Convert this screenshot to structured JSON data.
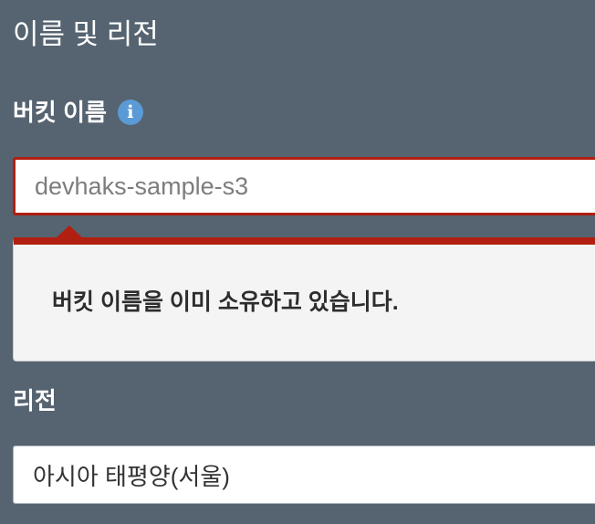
{
  "section": {
    "title": "이름 및 리전"
  },
  "bucket_name": {
    "label": "버킷 이름",
    "info_icon": "i",
    "value": "devhaks-sample-s3",
    "error_message": "버킷 이름을 이미 소유하고 있습니다."
  },
  "region": {
    "label": "리전",
    "selected": "아시아 태평양(서울)"
  },
  "colors": {
    "background": "#566370",
    "error": "#b11f10",
    "info": "#5b9bd5",
    "error_box_bg": "#f3f4f3"
  },
  "icons": {
    "info": "info-icon"
  }
}
